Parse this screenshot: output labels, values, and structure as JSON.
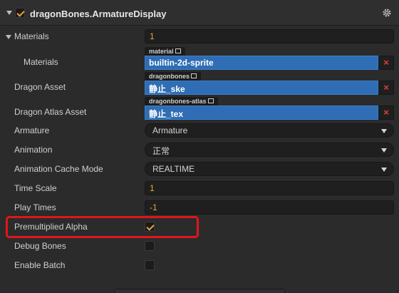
{
  "header": {
    "title": "dragonBones.ArmatureDisplay",
    "enabled": true
  },
  "materials": {
    "label": "Materials",
    "count": "1",
    "item_label": "Materials",
    "tag": "material",
    "value": "builtin-2d-sprite"
  },
  "dragon_asset": {
    "label": "Dragon Asset",
    "tag": "dragonbones",
    "value": "静止_ske"
  },
  "dragon_atlas_asset": {
    "label": "Dragon Atlas Asset",
    "tag": "dragonbones-atlas",
    "value": "静止_tex"
  },
  "armature": {
    "label": "Armature",
    "value": "Armature"
  },
  "animation": {
    "label": "Animation",
    "value": "正常"
  },
  "animation_cache_mode": {
    "label": "Animation Cache Mode",
    "value": "REALTIME"
  },
  "time_scale": {
    "label": "Time Scale",
    "value": "1"
  },
  "play_times": {
    "label": "Play Times",
    "value": "-1"
  },
  "premultiplied_alpha": {
    "label": "Premultiplied Alpha",
    "checked": true
  },
  "debug_bones": {
    "label": "Debug Bones",
    "checked": false
  },
  "enable_batch": {
    "label": "Enable Batch",
    "checked": false
  },
  "icons": {
    "clear": "×",
    "settings": "gear-icon",
    "link": "external-link-icon"
  },
  "colors": {
    "accent": "#f0a03a",
    "asset_field": "#2f6db5",
    "highlight": "#e0161b",
    "clear": "#e04040"
  }
}
